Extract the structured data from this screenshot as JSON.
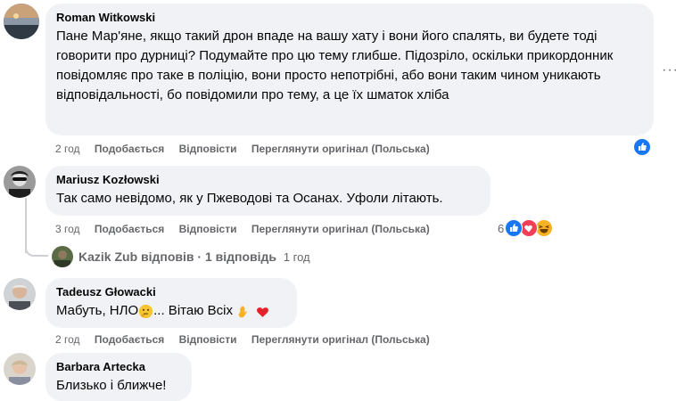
{
  "comments": [
    {
      "author": "Roman Witkowski",
      "text": "Пане Мар'яне, якщо такий дрон впаде на вашу хату і вони його спалять, ви будете тоді говорити про дурниці? Подумайте про цю тему глибше. Підозріло, оскільки прикордонник повідомляє про таке в поліцію, вони просто непотрібні, або вони таким чином уникають відповідальності, бо повідомили про тему, а це їх шматок хліба",
      "time": "2 год",
      "like_label": "Подобається",
      "reply_label": "Відповісти",
      "see_original_label": "Переглянути оригінал (Польська)",
      "reactions": [
        "like"
      ]
    },
    {
      "author": "Mariusz Kozłowski",
      "text": "Так само невідомо, як у Пжеводові та Осанах. Уфоли літають.",
      "time": "3 год",
      "like_label": "Подобається",
      "reply_label": "Відповісти",
      "see_original_label": "Переглянути оригінал (Польська)",
      "reaction_count": "6",
      "reactions": [
        "like",
        "love",
        "haha"
      ],
      "reply_summary": {
        "name": "Kazik Zub",
        "verb": "відповів",
        "separator": "·",
        "count": "1 відповідь",
        "time": "1 год"
      }
    },
    {
      "author": "Tadeusz Głowacki",
      "text": "Мабуть, НЛО",
      "text_suffix": "... Вітаю Всіх",
      "time": "2 год",
      "like_label": "Подобається",
      "reply_label": "Відповісти",
      "see_original_label": "Переглянути оригінал (Польська)"
    },
    {
      "author": "Barbara Artecka",
      "text": "Близько і ближче!"
    }
  ],
  "menu": {
    "dots": "···"
  },
  "icons": {
    "like": "thumbs-up-icon",
    "love": "heart-icon",
    "haha": "laughing-face-icon",
    "thinking": "thinking-face-icon",
    "wave": "waving-hand-icon",
    "red_heart": "red-heart-icon"
  },
  "colors": {
    "bubble": "#f0f2f5",
    "secondary_text": "#65676b",
    "like_blue": "#1877f2",
    "love_red": "#f33e58",
    "haha_yellow": "#f7b125"
  }
}
